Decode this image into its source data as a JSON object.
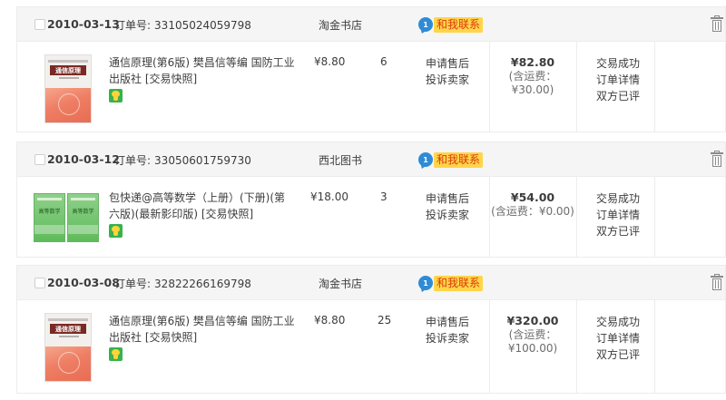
{
  "order_no_label": "订单号:",
  "contact_label": "和我联系",
  "contact_bubble": "1",
  "orders": [
    {
      "date": "2010-03-13",
      "order_no": "33105024059798",
      "shop": "淘金书店",
      "item_title": "通信原理(第6版) 樊昌信等编 国防工业出版社",
      "snapshot": "[交易快照]",
      "book_cover_text": "通信原理",
      "price": "¥8.80",
      "qty": "6",
      "after_sale": [
        "申请售后",
        "投诉卖家"
      ],
      "total": "¥82.80",
      "shipping": "(含运费：¥30.00)",
      "status": [
        "交易成功",
        "订单详情",
        "双方已评"
      ]
    },
    {
      "date": "2010-03-12",
      "order_no": "33050601759730",
      "shop": "西北图书",
      "item_title": "包快递@高等数学（上册）(下册)(第六版)(最新影印版)",
      "snapshot": "[交易快照]",
      "book_cover_text": "高等数学",
      "price": "¥18.00",
      "qty": "3",
      "after_sale": [
        "申请售后",
        "投诉卖家"
      ],
      "total": "¥54.00",
      "shipping": "(含运费：¥0.00)",
      "status": [
        "交易成功",
        "订单详情",
        "双方已评"
      ]
    },
    {
      "date": "2010-03-08",
      "order_no": "32822266169798",
      "shop": "淘金书店",
      "item_title": "通信原理(第6版) 樊昌信等编 国防工业出版社",
      "snapshot": "[交易快照]",
      "book_cover_text": "通信原理",
      "price": "¥8.80",
      "qty": "25",
      "after_sale": [
        "申请售后",
        "投诉卖家"
      ],
      "total": "¥320.00",
      "shipping_line1": "(含运费：",
      "shipping_line2": "¥100.00)",
      "status": [
        "交易成功",
        "订单详情",
        "双方已评"
      ]
    }
  ]
}
